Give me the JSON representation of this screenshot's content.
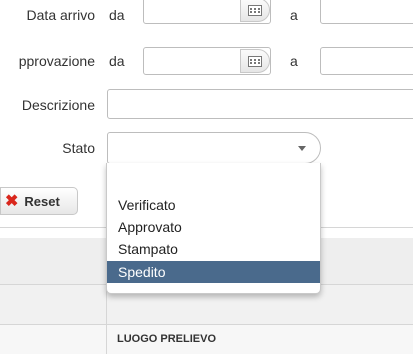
{
  "form": {
    "data_arrivo_label": "Data arrivo",
    "data_arrivo_from": "da",
    "data_arrivo_to": "a",
    "approvazione_label": "pprovazione",
    "approvazione_from": "da",
    "approvazione_to": "a",
    "descrizione_label": "Descrizione",
    "stato_label": "Stato",
    "stato_value": ""
  },
  "buttons": {
    "reset_label": "Reset"
  },
  "dropdown": {
    "options": [
      "",
      "Verificato",
      "Approvato",
      "Stampato",
      "Spedito"
    ],
    "selected_index": 4
  },
  "table": {
    "column_header": "LUOGO PRELIEVO"
  },
  "icons": {
    "calendar": "calendar-icon",
    "reset": "close-icon",
    "chevron": "chevron-down-icon"
  },
  "colors": {
    "selected_option": "#4a6a8c",
    "reset_icon": "#d9261c",
    "band": "#eeeeee"
  }
}
